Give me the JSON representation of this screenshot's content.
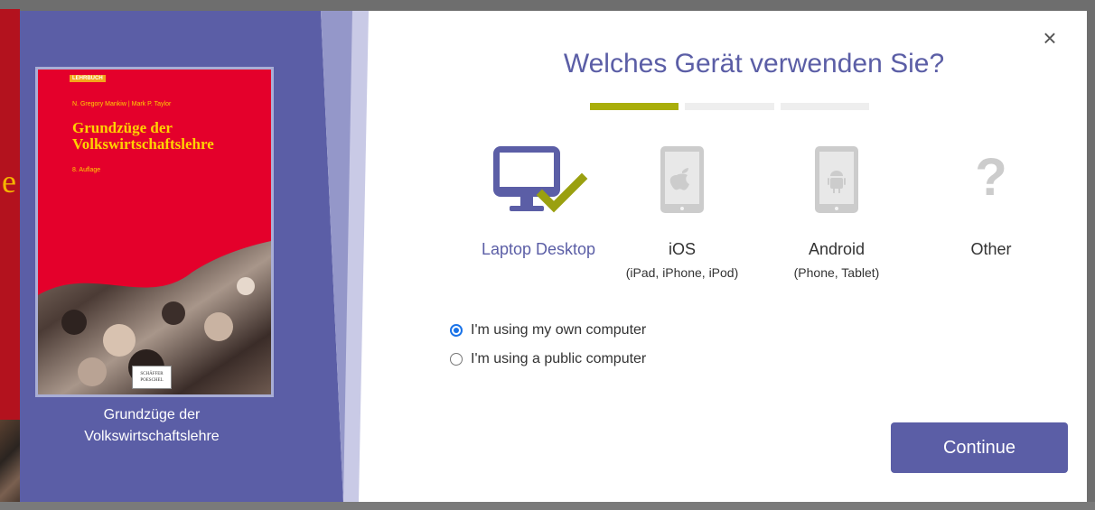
{
  "background": {
    "partial_letter": "e"
  },
  "modal": {
    "title": "Welches Gerät verwenden Sie?",
    "close_label": "×",
    "progress_steps_total": 3,
    "progress_current_step": 1,
    "book": {
      "caption": "Grundzüge der Volkswirtschaftslehre",
      "cover": {
        "tag": "LEHRBUCH",
        "authors": "N. Gregory Mankiw | Mark P. Taylor",
        "title": "Grundzüge der Volkswirtschaftslehre",
        "edition": "8. Auflage",
        "publisher": "SCHÄFFER POESCHEL"
      }
    },
    "devices": [
      {
        "label": "Laptop Desktop",
        "sub": "",
        "icon": "monitor-check-icon",
        "selected": true
      },
      {
        "label": "iOS",
        "sub": "(iPad, iPhone, iPod)",
        "icon": "apple-tablet-icon",
        "selected": false
      },
      {
        "label": "Android",
        "sub": "(Phone, Tablet)",
        "icon": "android-tablet-icon",
        "selected": false
      },
      {
        "label": "Other",
        "sub": "",
        "icon": "question-mark-icon",
        "selected": false
      }
    ],
    "computer_options": [
      {
        "label": "I'm using my own computer",
        "checked": true
      },
      {
        "label": "I'm using a public computer",
        "checked": false
      }
    ],
    "continue_label": "Continue"
  },
  "colors": {
    "accent": "#5b5ea6",
    "progress_active": "#a9ae0a",
    "checkmark": "#9aa010",
    "icon_gray": "#cccccc",
    "cover_red": "#e4002b",
    "cover_yellow": "#ffd200"
  }
}
